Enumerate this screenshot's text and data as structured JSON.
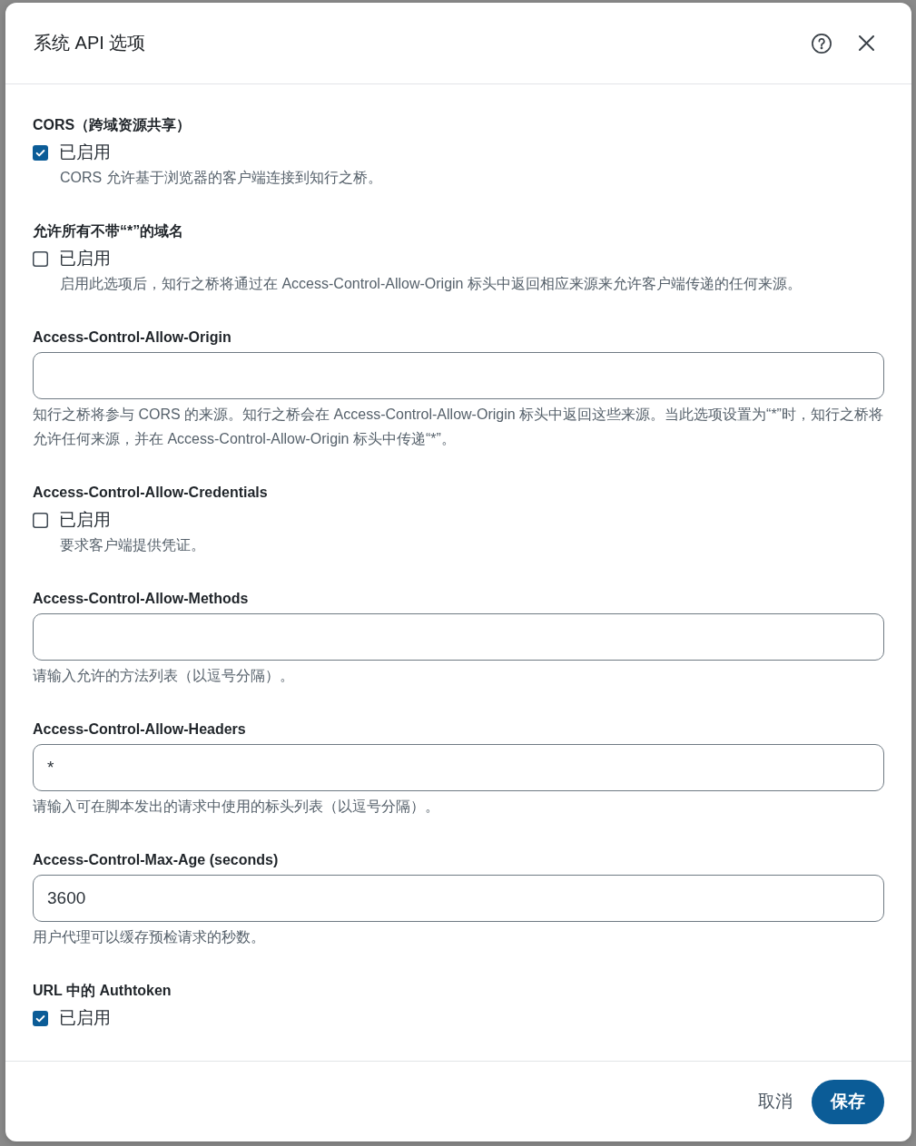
{
  "dialog": {
    "title": "系统 API 选项"
  },
  "sections": [
    {
      "kind": "checkbox",
      "label": "CORS（跨域资源共享）",
      "option": "已启用",
      "checked": true,
      "description": "CORS 允许基于浏览器的客户端连接到知行之桥。"
    },
    {
      "kind": "checkbox",
      "label": "允许所有不带“*”的域名",
      "option": "已启用",
      "checked": false,
      "description": "启用此选项后，知行之桥将通过在 Access-Control-Allow-Origin 标头中返回相应来源来允许客户端传递的任何来源。"
    },
    {
      "kind": "text",
      "label": "Access-Control-Allow-Origin",
      "hint": "知行之桥将参与 CORS 的来源。知行之桥会在 Access-Control-Allow-Origin 标头中返回这些来源。当此选项设置为“*”时，知行之桥将允许任何来源，并在 Access-Control-Allow-Origin 标头中传递“*”。"
    },
    {
      "kind": "checkbox",
      "label": "Access-Control-Allow-Credentials",
      "option": "已启用",
      "checked": false,
      "description": "要求客户端提供凭证。"
    },
    {
      "kind": "text",
      "label": "Access-Control-Allow-Methods",
      "hint": "请输入允许的方法列表（以逗号分隔）。"
    },
    {
      "kind": "text",
      "label": "Access-Control-Allow-Headers",
      "value": "*",
      "hint": "请输入可在脚本发出的请求中使用的标头列表（以逗号分隔）。"
    },
    {
      "kind": "text",
      "label": "Access-Control-Max-Age (seconds)",
      "value": "3600",
      "hint": "用户代理可以缓存预检请求的秒数。"
    },
    {
      "kind": "checkbox",
      "label": "URL 中的 Authtoken",
      "option": "已启用",
      "checked": true
    }
  ],
  "buttons": [
    {
      "kind": "text",
      "label": "取消"
    },
    {
      "kind": "primary",
      "label": "保存"
    }
  ]
}
